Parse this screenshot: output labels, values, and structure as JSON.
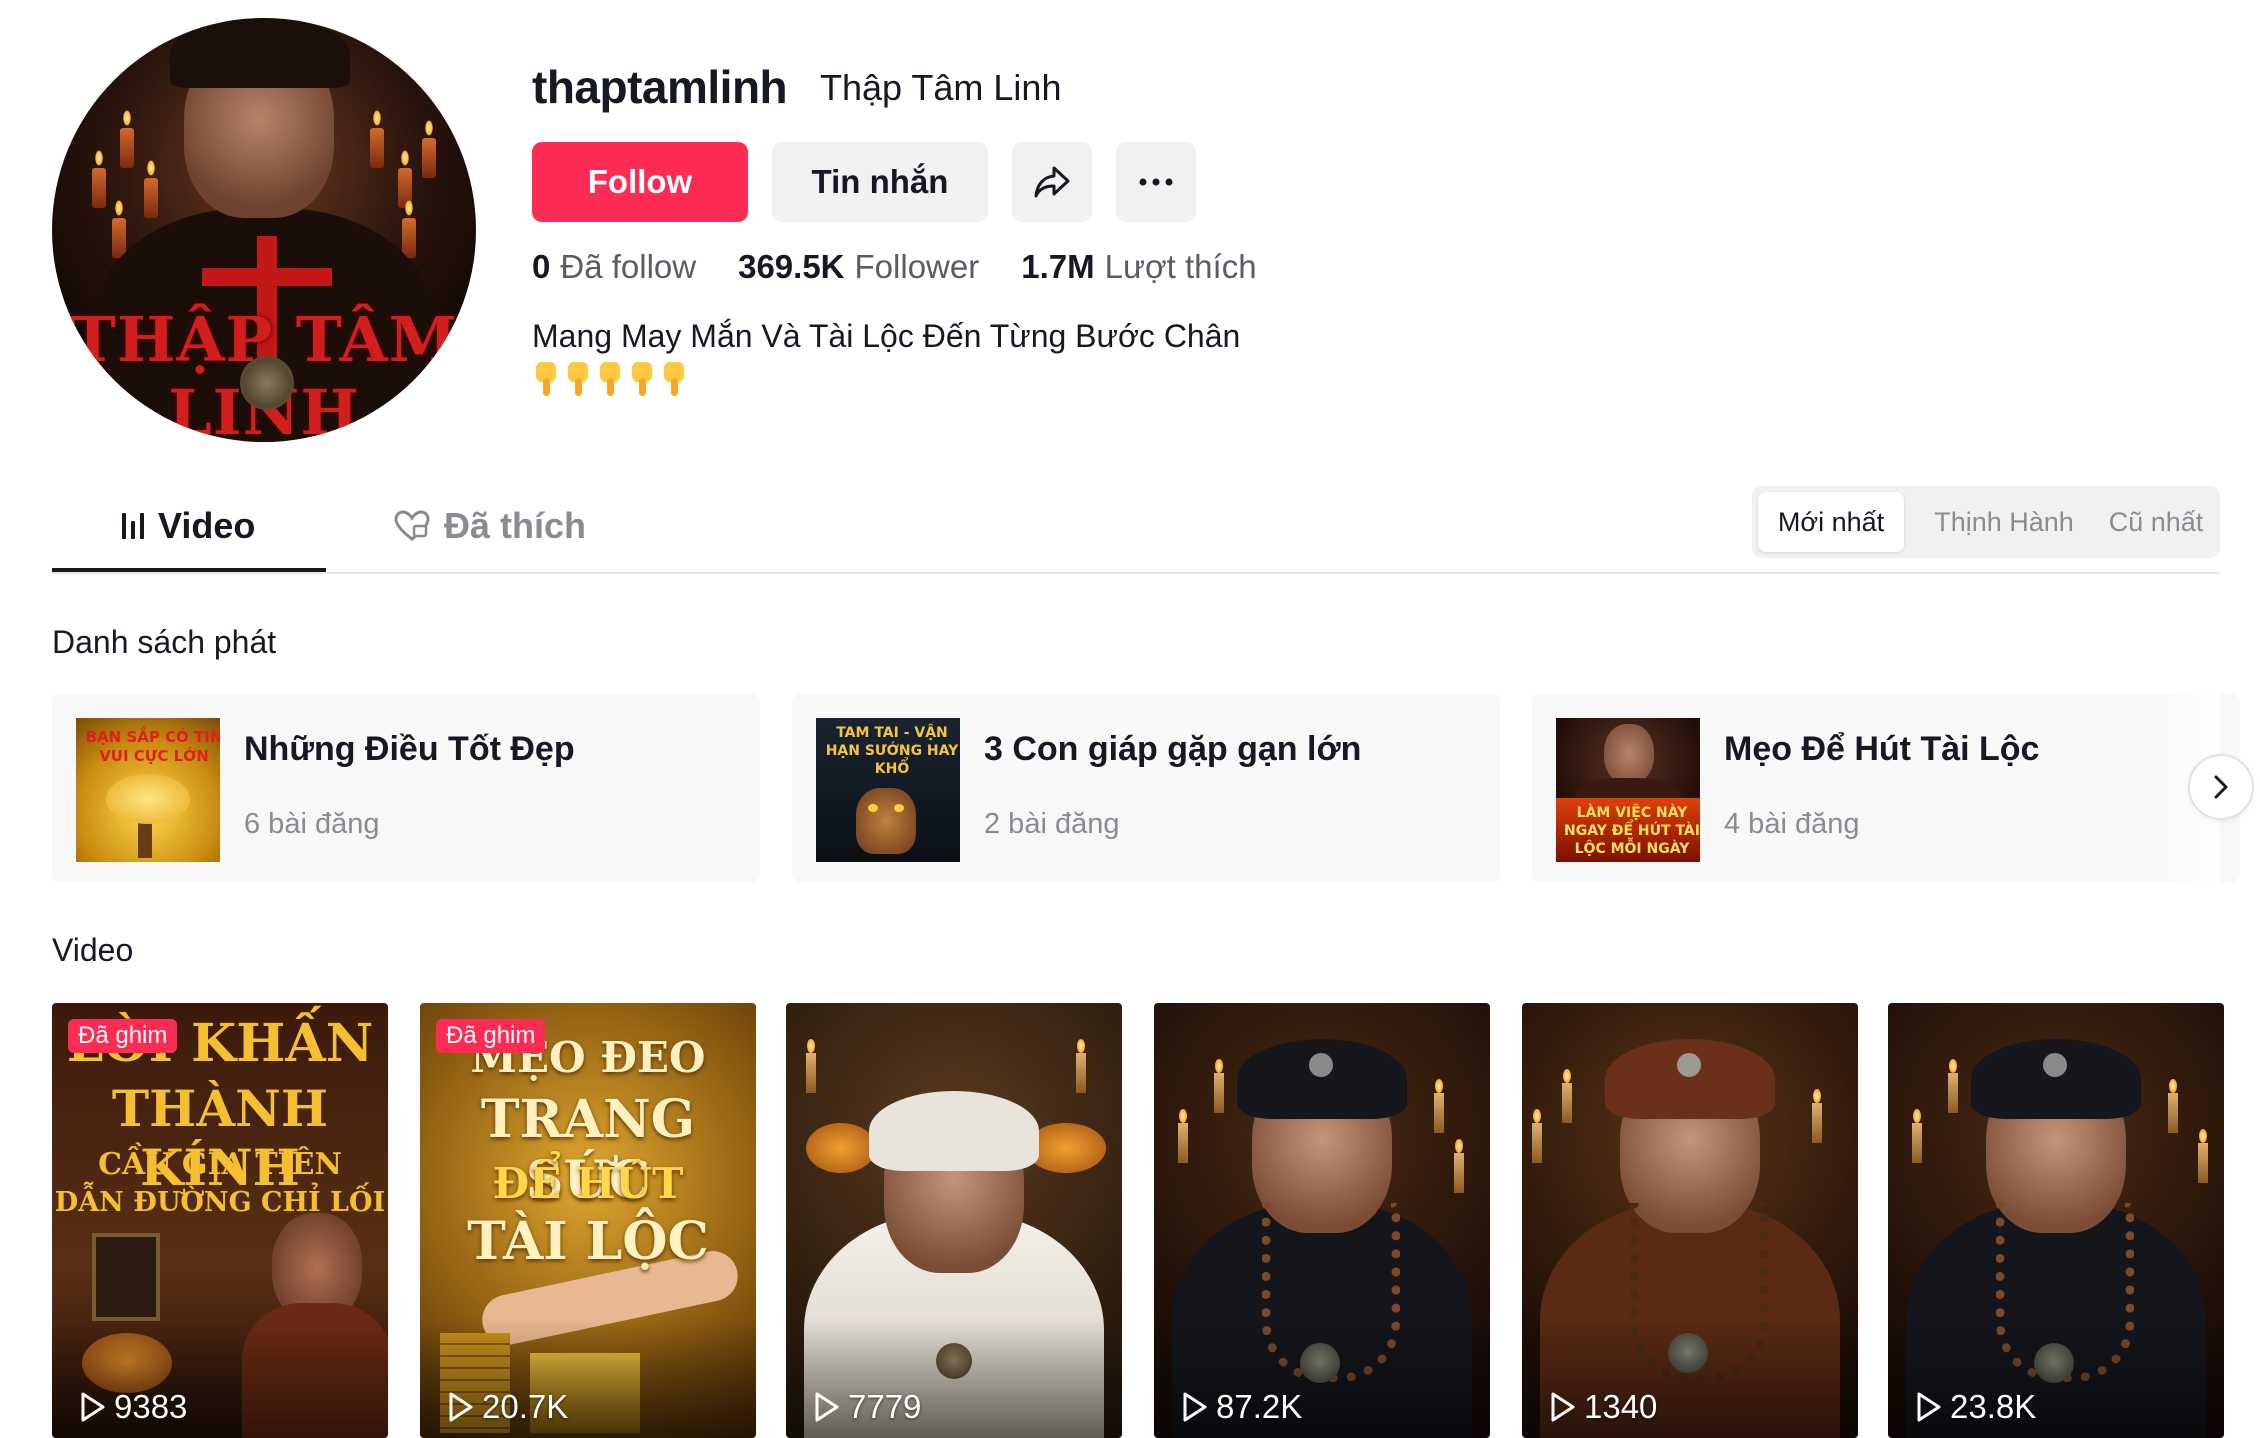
{
  "profile": {
    "avatar_text": "THẬP TÂM LINH",
    "username": "thaptamlinh",
    "nickname": "Thập Tâm Linh",
    "follow_label": "Follow",
    "message_label": "Tin nhắn",
    "share_icon": "share-icon",
    "more_icon": "more-icon",
    "stats": [
      {
        "value": "0",
        "label": "Đã follow"
      },
      {
        "value": "369.5K",
        "label": "Follower"
      },
      {
        "value": "1.7M",
        "label": "Lượt thích"
      }
    ],
    "bio": "Mang May Mắn Và Tài Lộc Đến Từng Bước Chân",
    "bio_emoji": "👇👇👇👇👇",
    "brand_color": "#fe2c55"
  },
  "tabs": {
    "video_label": "Video",
    "liked_label": "Đã thích",
    "active": "video"
  },
  "sort": {
    "options": [
      "Mới nhất",
      "Thịnh Hành",
      "Cũ nhất"
    ],
    "active": "Mới nhất"
  },
  "playlists": {
    "heading": "Danh sách phát",
    "items": [
      {
        "name": "Những Điều Tốt Đẹp",
        "count": "6 bài đăng",
        "thumb_text": "BẠN SẮP CÓ TIN VUI CỰC LỚN"
      },
      {
        "name": "3 Con giáp gặp gạn lớn",
        "count": "2 bài đăng",
        "thumb_text": "TAM TAI - VẬN HẠN SƯỚNG HAY KHỔ"
      },
      {
        "name": "Mẹo Để Hút Tài Lộc",
        "count": "4 bài đăng",
        "thumb_text": "LÀM VIỆC NÀY NGAY ĐỂ HÚT TÀI LỘC MỖI NGÀY"
      }
    ],
    "next_icon": "chevron-right-icon"
  },
  "videos": {
    "heading": "Video",
    "pinned_label": "Đã ghim",
    "items": [
      {
        "views": "9383",
        "pinned": true,
        "title_lines": [
          "LỜI KHẤN",
          "THÀNH KÍNH",
          "CẦU GIA TIÊN",
          "DẪN ĐƯỜNG CHỈ LỐI"
        ]
      },
      {
        "views": "20.7K",
        "pinned": true,
        "title_lines": [
          "MẸO ĐEO",
          "TRANG SỨC",
          "ĐỂ HÚT",
          "TÀI LỘC"
        ]
      },
      {
        "views": "7779",
        "pinned": false
      },
      {
        "views": "87.2K",
        "pinned": false
      },
      {
        "views": "1340",
        "pinned": false
      },
      {
        "views": "23.8K",
        "pinned": false
      }
    ]
  }
}
